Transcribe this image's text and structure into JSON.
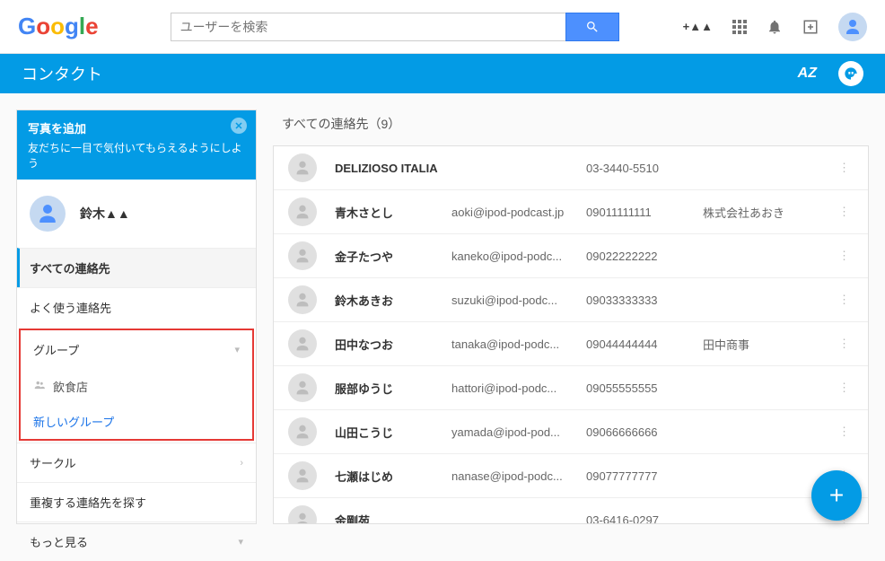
{
  "header": {
    "logo_text": "Google",
    "search_placeholder": "ユーザーを検索",
    "plus_user": "+▲▲"
  },
  "blue_bar": {
    "title": "コンタクト"
  },
  "sidebar": {
    "promo_title": "写真を追加",
    "promo_text": "友だちに一目で気付いてもらえるようにしよう",
    "profile_name": "鈴木▲▲",
    "nav_all": "すべての連絡先",
    "nav_freq": "よく使う連絡先",
    "nav_groups": "グループ",
    "group_restaurant": "飲食店",
    "new_group": "新しいグループ",
    "nav_circles": "サークル",
    "nav_dup": "重複する連絡先を探す",
    "nav_more": "もっと見る"
  },
  "content": {
    "title": "すべての連絡先（9）",
    "contacts": [
      {
        "name": "DELIZIOSO ITALIA",
        "email": "",
        "phone": "03-3440-5510",
        "company": ""
      },
      {
        "name": "青木さとし",
        "email": "aoki@ipod-podcast.jp",
        "phone": "09011111111",
        "company": "株式会社あおき"
      },
      {
        "name": "金子たつや",
        "email": "kaneko@ipod-podc...",
        "phone": "09022222222",
        "company": ""
      },
      {
        "name": "鈴木あきお",
        "email": "suzuki@ipod-podc...",
        "phone": "09033333333",
        "company": ""
      },
      {
        "name": "田中なつお",
        "email": "tanaka@ipod-podc...",
        "phone": "09044444444",
        "company": "田中商事"
      },
      {
        "name": "服部ゆうじ",
        "email": "hattori@ipod-podc...",
        "phone": "09055555555",
        "company": ""
      },
      {
        "name": "山田こうじ",
        "email": "yamada@ipod-pod...",
        "phone": "09066666666",
        "company": ""
      },
      {
        "name": "七瀬はじめ",
        "email": "nanase@ipod-podc...",
        "phone": "09077777777",
        "company": ""
      },
      {
        "name": "金剛苑",
        "email": "",
        "phone": "03-6416-0297",
        "company": ""
      }
    ]
  }
}
